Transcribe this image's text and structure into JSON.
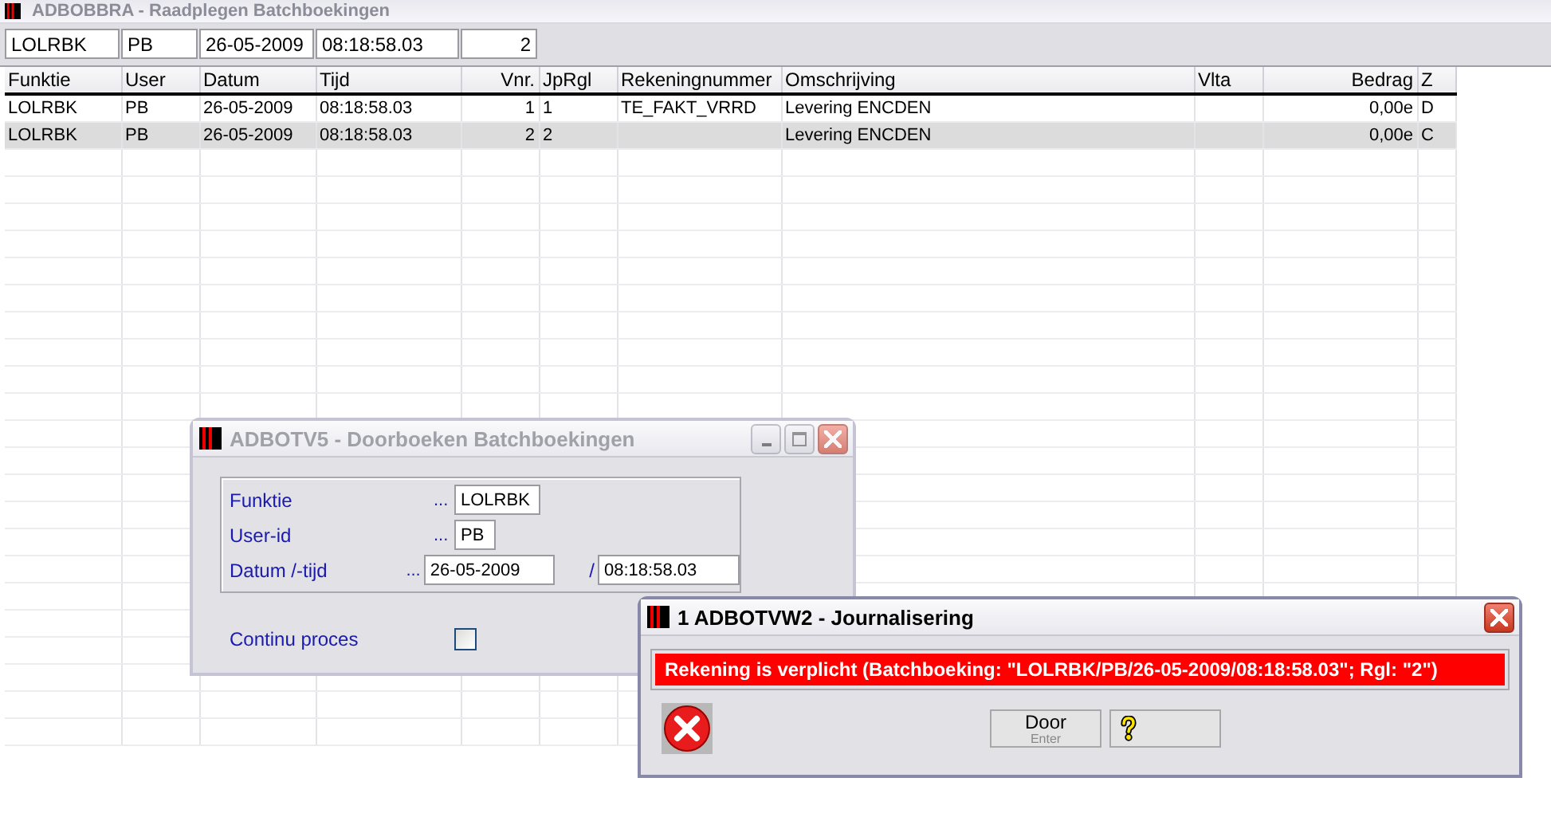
{
  "window": {
    "title": "ADBOBBRA - Raadplegen Batchboekingen"
  },
  "summary": [
    "LOLRBK",
    "PB",
    "26-05-2009",
    "08:18:58.03",
    "2"
  ],
  "table": {
    "columns": [
      {
        "label": "Funktie"
      },
      {
        "label": "User"
      },
      {
        "label": "Datum"
      },
      {
        "label": "Tijd"
      },
      {
        "label": "Vnr."
      },
      {
        "label": "JpRgl"
      },
      {
        "label": "Rekeningnummer"
      },
      {
        "label": "Omschrijving"
      },
      {
        "label": "Vlta"
      },
      {
        "label": "Bedrag"
      },
      {
        "label": "Z"
      }
    ],
    "rows": [
      {
        "selected": false,
        "cells": [
          "LOLRBK",
          "PB",
          "26-05-2009",
          "08:18:58.03",
          "1",
          "1",
          "TE_FAKT_VRRD",
          "Levering ENCDEN",
          "",
          "0,00e",
          "D"
        ]
      },
      {
        "selected": true,
        "cells": [
          "LOLRBK",
          "PB",
          "26-05-2009",
          "08:18:58.03",
          "2",
          "2",
          "",
          "Levering ENCDEN",
          "",
          "0,00e",
          "C"
        ]
      }
    ]
  },
  "dialog": {
    "title": "ADBOTV5 - Doorboeken Batchboekingen",
    "active": false,
    "fields": [
      {
        "label": "Funktie",
        "dots": "...",
        "values": [
          "LOLRBK"
        ]
      },
      {
        "label": "User-id",
        "dots": "...",
        "values": [
          "PB"
        ]
      },
      {
        "label": "Datum /-tijd",
        "dots": "...",
        "values": [
          "26-05-2009",
          "08:18:58.03"
        ],
        "separator": "/"
      }
    ],
    "checkbox": {
      "label": "Continu proces",
      "checked": false
    }
  },
  "message": {
    "title": "1 ADBOTVW2 - Journalisering",
    "active": true,
    "text": "Rekening is verplicht (Batchboeking: \"LOLRBK/PB/26-05-2009/08:18:58.03\"; Rgl: \"2\")",
    "buttons": [
      {
        "kind": "text",
        "label": "Door",
        "hint": "Enter"
      },
      {
        "kind": "help"
      }
    ]
  }
}
